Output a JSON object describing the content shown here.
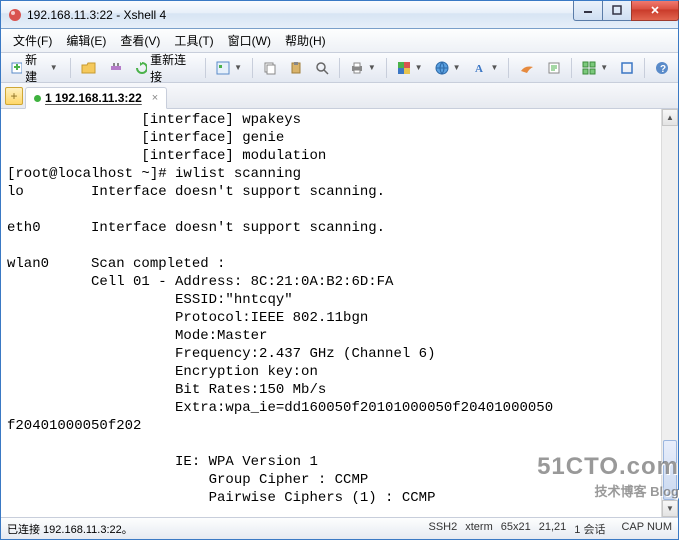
{
  "titlebar": {
    "title": "192.168.11.3:22 - Xshell 4"
  },
  "menu": {
    "file": "文件(F)",
    "edit": "编辑(E)",
    "view": "查看(V)",
    "tools": "工具(T)",
    "window": "窗口(W)",
    "help": "帮助(H)"
  },
  "toolbar": {
    "new": "新建",
    "reconnect": "重新连接"
  },
  "tab": {
    "label": "1 192.168.11.3:22"
  },
  "terminal": "                [interface] wpakeys\n                [interface] genie\n                [interface] modulation\n[root@localhost ~]# iwlist scanning\nlo        Interface doesn't support scanning.\n\neth0      Interface doesn't support scanning.\n\nwlan0     Scan completed :\n          Cell 01 - Address: 8C:21:0A:B2:6D:FA\n                    ESSID:\"hntcqy\"\n                    Protocol:IEEE 802.11bgn\n                    Mode:Master\n                    Frequency:2.437 GHz (Channel 6)\n                    Encryption key:on\n                    Bit Rates:150 Mb/s\n                    Extra:wpa_ie=dd160050f20101000050f20401000050\nf20401000050f202\n\n                    IE: WPA Version 1\n                        Group Cipher : CCMP\n                        Pairwise Ciphers (1) : CCMP",
  "status": {
    "left": "已连接 192.168.11.3:22。",
    "proto": "SSH2",
    "term": "xterm",
    "size": "65x21",
    "pos": "21,21",
    "sess": "1 会话",
    "cap": "CAP",
    "num": "NUM"
  },
  "watermark": {
    "big": "51CTO.com",
    "sm": "技术博客  Blog"
  }
}
